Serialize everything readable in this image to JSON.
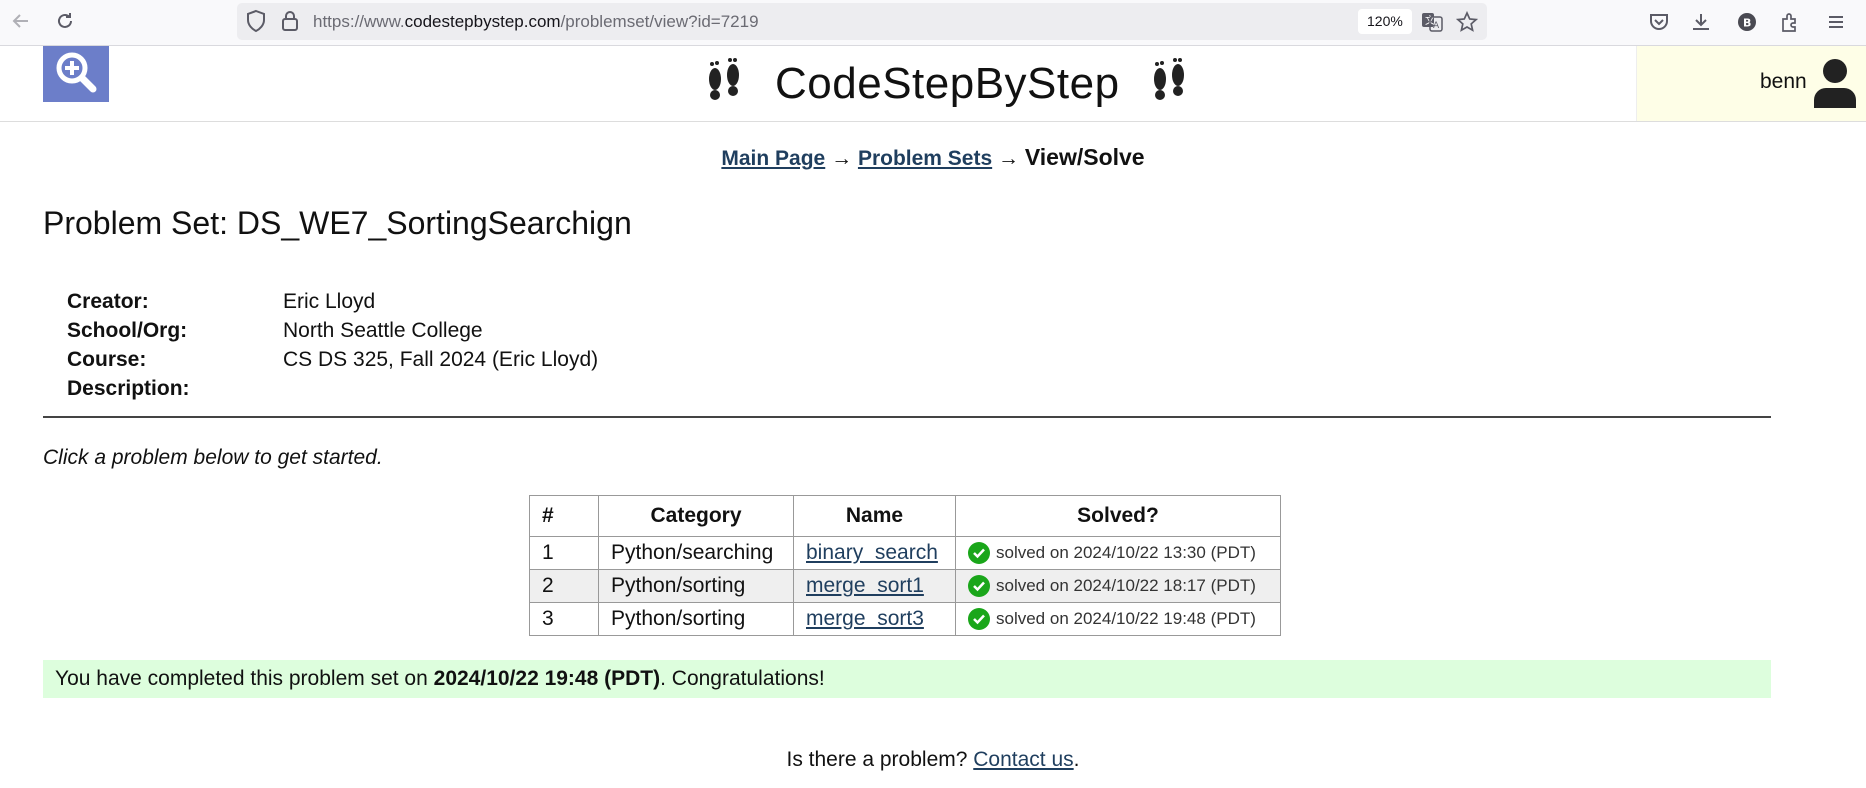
{
  "browser": {
    "url_prefix": "https://www.",
    "url_domain": "codestepbystep.com",
    "url_path": "/problemset/view?id=7219",
    "zoom": "120%"
  },
  "site": {
    "name": "CodeStepByStep",
    "user_name": "benn"
  },
  "breadcrumb": {
    "main_page": "Main Page",
    "problem_sets": "Problem Sets",
    "current": "View/Solve",
    "arrow": "→"
  },
  "problem_set": {
    "title": "Problem Set: DS_WE7_SortingSearchign",
    "creator_label": "Creator:",
    "creator": "Eric Lloyd",
    "school_label": "School/Org:",
    "school": "North Seattle College",
    "course_label": "Course:",
    "course": "CS DS 325, Fall 2024 (Eric Lloyd)",
    "description_label": "Description:",
    "description": ""
  },
  "hint": "Click a problem below to get started.",
  "table": {
    "headers": [
      "#",
      "Category",
      "Name",
      "Solved?"
    ],
    "rows": [
      {
        "num": "1",
        "category": "Python/searching",
        "name": "binary_search",
        "solved": "solved on 2024/10/22 13:30 (PDT)"
      },
      {
        "num": "2",
        "category": "Python/sorting",
        "name": "merge_sort1",
        "solved": "solved on 2024/10/22 18:17 (PDT)"
      },
      {
        "num": "3",
        "category": "Python/sorting",
        "name": "merge_sort3",
        "solved": "solved on 2024/10/22 19:48 (PDT)"
      }
    ]
  },
  "congrats": {
    "prefix": "You have completed this problem set on ",
    "date": "2024/10/22 19:48 (PDT)",
    "suffix": ". Congratulations!"
  },
  "footer": {
    "question": "Is there a problem? ",
    "link": "Contact us",
    "end": "."
  },
  "colors": {
    "link": "#1f3e5e",
    "congrats_bg": "#ddfedd",
    "user_bg": "#fefee7",
    "check": "#1aa61a"
  }
}
